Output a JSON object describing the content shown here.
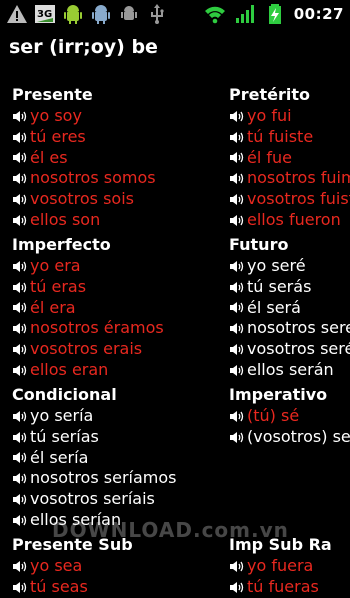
{
  "status_bar": {
    "icons": [
      "warning-icon",
      "3g-icon",
      "android-icon",
      "android-icon",
      "debug-icon",
      "usb-icon",
      "wifi-icon",
      "signal-icon",
      "battery-charging-icon"
    ],
    "time": "00:27"
  },
  "page": {
    "title": "ser (irr;oy) be"
  },
  "colors": {
    "red": "#e8281f",
    "white": "#ffffff",
    "background": "#000000"
  },
  "tenses": {
    "presente": {
      "title": "Presente",
      "color": "red",
      "forms": [
        "yo soy",
        "tú eres",
        "él es",
        "nosotros somos",
        "vosotros sois",
        "ellos son"
      ]
    },
    "preterito": {
      "title": "Pretérito",
      "color": "red",
      "forms": [
        "yo fui",
        "tú fuiste",
        "él fue",
        "nosotros fuimos",
        "vosotros fuisteis",
        "ellos fueron"
      ]
    },
    "imperfecto": {
      "title": "Imperfecto",
      "color": "red",
      "forms": [
        "yo era",
        "tú eras",
        "él era",
        "nosotros éramos",
        "vosotros erais",
        "ellos eran"
      ]
    },
    "futuro": {
      "title": "Futuro",
      "color": "white",
      "forms": [
        "yo seré",
        "tú serás",
        "él será",
        "nosotros seremos",
        "vosotros seréis",
        "ellos serán"
      ]
    },
    "condicional": {
      "title": "Condicional",
      "color": "white",
      "forms": [
        "yo sería",
        "tú serías",
        "él sería",
        "nosotros seríamos",
        "vosotros seríais",
        "ellos serían"
      ]
    },
    "imperativo": {
      "title": "Imperativo",
      "color": "mixed",
      "forms": [
        "(tú) sé",
        "(vosotros) sed"
      ]
    },
    "presente_sub": {
      "title": "Presente Sub",
      "color": "red",
      "forms": [
        "yo sea",
        "tú seas"
      ]
    },
    "imp_sub_ra": {
      "title": "Imp Sub Ra",
      "color": "red",
      "forms": [
        "yo fuera",
        "tú fueras"
      ]
    }
  },
  "watermark": "DOWNLOAD.com.vn"
}
